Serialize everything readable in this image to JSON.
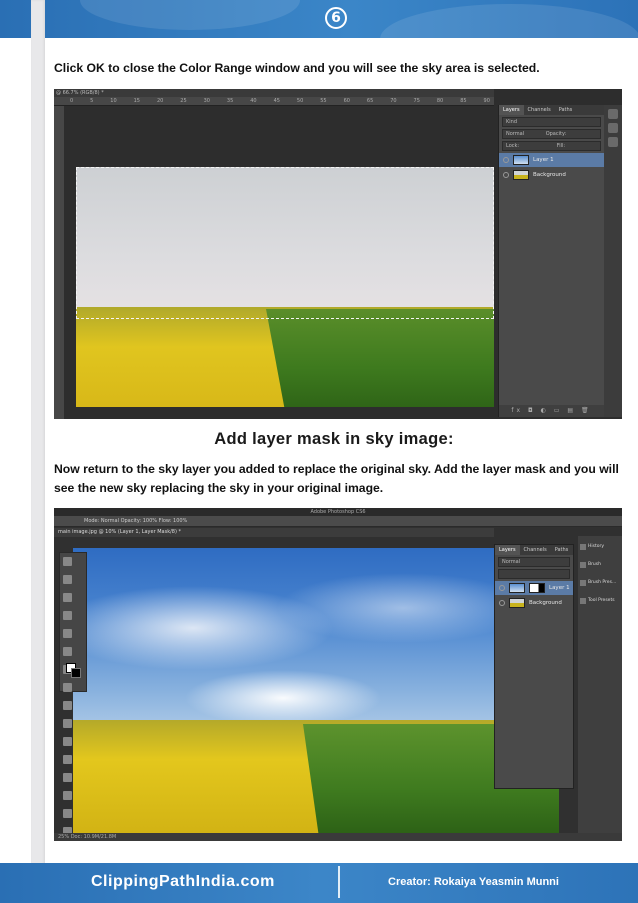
{
  "header": {
    "page_number": "6"
  },
  "section1": {
    "instruction": "Click OK to close the Color Range window and you will see the sky area is selected.",
    "screenshot": {
      "doc_tab": "@ 66.7% (RGB/8) *",
      "ruler_ticks": [
        "0",
        "5",
        "10",
        "15",
        "20",
        "25",
        "30",
        "35",
        "40",
        "45",
        "50",
        "55",
        "60",
        "65",
        "70",
        "75",
        "80",
        "85",
        "90"
      ],
      "panel_tabs": [
        "Layers",
        "Channels",
        "Paths"
      ],
      "kind_label": "Kind",
      "blend_mode": "Normal",
      "opacity_label": "Opacity:",
      "fill_label": "Fill:",
      "lock_label": "Lock:",
      "layers": [
        {
          "name": "Layer 1",
          "selected": true
        },
        {
          "name": "Background",
          "selected": false
        }
      ],
      "footer_icons": "fx ◘ ◐ ▭ ▤ 🗑"
    }
  },
  "section2": {
    "heading": "Add layer mask in sky image:",
    "instruction": "Now return to the sky layer you added to replace the original sky. Add the layer mask and you will see the new sky replacing the sky in your original image.",
    "screenshot": {
      "window_title": "Adobe Photoshop CS6",
      "options_bar": "Mode: Normal   Opacity: 100%   Flow: 100%",
      "doc_tab": "main image.jpg @ 10% (Layer 1, Layer Mask/8) *",
      "status_bar": "25%      Doc: 10.9M/21.8M",
      "panel_tabs": [
        "Layers",
        "Channels",
        "Paths"
      ],
      "blend_mode": "Normal",
      "layers": [
        {
          "name": "Layer 1",
          "selected": true
        },
        {
          "name": "Background",
          "selected": false
        }
      ],
      "right_dock": [
        "History",
        "Brush",
        "Brush Pres...",
        "Tool Presets"
      ]
    }
  },
  "footer": {
    "brand": "ClippingPathIndia.com",
    "creator": "Creator: Rokaiya Yeasmin Munni"
  },
  "colors": {
    "band_blue": "#3b86c8",
    "panel_gray": "#4a4a4a",
    "selected_layer": "#5b7ba6"
  }
}
